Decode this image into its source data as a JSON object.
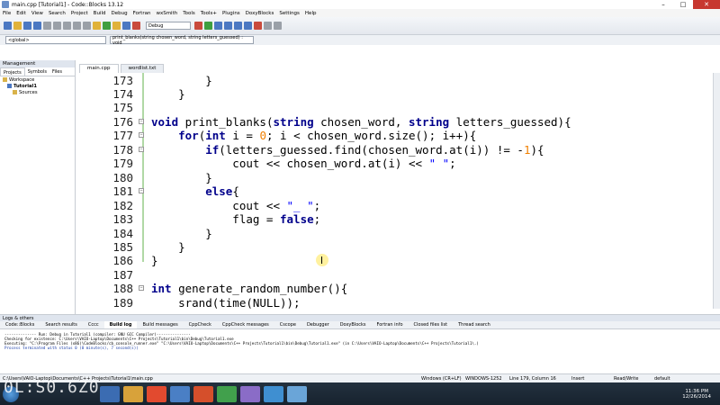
{
  "window": {
    "title": "main.cpp [Tutorial1] - Code::Blocks 13.12"
  },
  "menu": [
    "File",
    "Edit",
    "View",
    "Search",
    "Project",
    "Build",
    "Debug",
    "Fortran",
    "wxSmith",
    "Tools",
    "Tools+",
    "Plugins",
    "DoxyBlocks",
    "Settings",
    "Help"
  ],
  "toolbar": {
    "build_target": "Debug"
  },
  "scope": {
    "left": "<global>",
    "func": "print_blanks(string chosen_word, string letters_guessed) : void"
  },
  "management": {
    "title": "Management",
    "tabs": [
      "Projects",
      "Symbols",
      "Files"
    ],
    "tree": [
      "Workspace",
      "Tutorial1",
      "Sources"
    ]
  },
  "editor_tabs": [
    "main.cpp",
    "wordlist.txt"
  ],
  "code": {
    "lines": [
      {
        "n": "173",
        "t": "        }"
      },
      {
        "n": "174",
        "t": "    }"
      },
      {
        "n": "175",
        "t": ""
      },
      {
        "n": "176",
        "t": "void print_blanks(string chosen_word, string letters_guessed){"
      },
      {
        "n": "177",
        "t": "    for(int i = 0; i < chosen_word.size(); i++){"
      },
      {
        "n": "178",
        "t": "        if(letters_guessed.find(chosen_word.at(i)) != -1){"
      },
      {
        "n": "179",
        "t": "            cout << chosen_word.at(i) << \" \";"
      },
      {
        "n": "180",
        "t": "        }"
      },
      {
        "n": "181",
        "t": "        else{"
      },
      {
        "n": "182",
        "t": "            cout << \"_ \";"
      },
      {
        "n": "183",
        "t": "            flag = false;"
      },
      {
        "n": "184",
        "t": "        }"
      },
      {
        "n": "185",
        "t": "    }"
      },
      {
        "n": "186",
        "t": "}"
      },
      {
        "n": "187",
        "t": ""
      },
      {
        "n": "188",
        "t": "int generate_random_number(){"
      },
      {
        "n": "189",
        "t": "    srand(time(NULL));"
      }
    ]
  },
  "logs": {
    "title": "Logs & others",
    "tabs": [
      "Code::Blocks",
      "Search results",
      "Cccc",
      "Build log",
      "Build messages",
      "CppCheck",
      "CppCheck messages",
      "Cscope",
      "Debugger",
      "DoxyBlocks",
      "Fortran info",
      "Closed files list",
      "Thread search"
    ],
    "text": [
      "-------------- Run: Debug in Tutorial1 (compiler: GNU GCC Compiler)---------------",
      "Checking for existence: C:\\Users\\VAIO-Laptop\\Documents\\C++ Projects\\Tutorial1\\bin\\Debug\\Tutorial1.exe",
      "Executing: \"C:\\Program Files (x86)\\CodeBlocks/cb_console_runner.exe\" \"C:\\Users\\VAIO-Laptop\\Documents\\C++ Projects\\Tutorial1\\bin\\Debug\\Tutorial1.exe\"  (in C:\\Users\\VAIO-Laptop\\Documents\\C++ Projects\\Tutorial1\\.)",
      "Process terminated with status 0 (0 minute(s), 7 second(s))"
    ]
  },
  "status": {
    "path": "C:\\Users\\VAIO-Laptop\\Documents\\C++ Projects\\Tutorial1\\main.cpp",
    "eol": "Windows (CR+LF)",
    "encoding": "WINDOWS-1252",
    "position": "Line 179, Column 16",
    "mode": "Insert",
    "rw": "Read/Write",
    "profile": "default"
  },
  "taskbar": {
    "time": "11:36 PM",
    "date": "12/26/2014"
  },
  "watermark": "0L:S0.6Z0"
}
